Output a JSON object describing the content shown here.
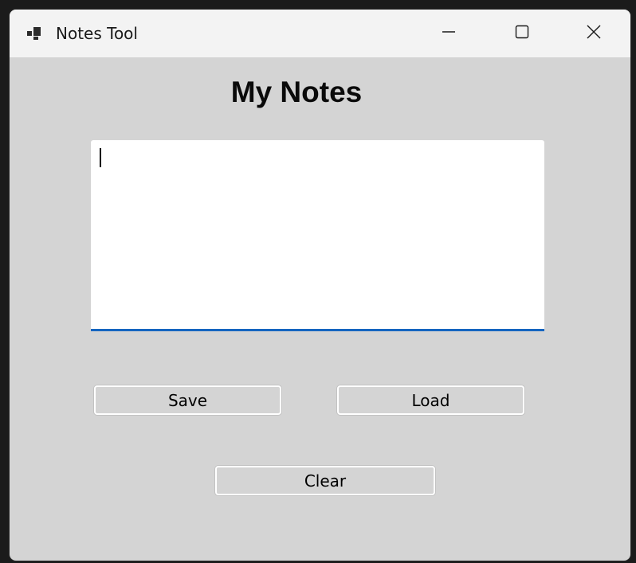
{
  "window": {
    "title": "Notes Tool",
    "icon": "app-window-icon",
    "controls": {
      "minimize_icon": "minimize-icon",
      "maximize_icon": "maximize-icon",
      "close_icon": "close-icon"
    }
  },
  "main": {
    "heading": "My Notes",
    "notes": {
      "value": "",
      "placeholder": ""
    },
    "buttons": {
      "save": "Save",
      "load": "Load",
      "clear": "Clear"
    }
  },
  "colors": {
    "window_bg": "#d4d4d4",
    "titlebar_bg": "#f3f3f3",
    "accent_underline": "#1565c0"
  }
}
